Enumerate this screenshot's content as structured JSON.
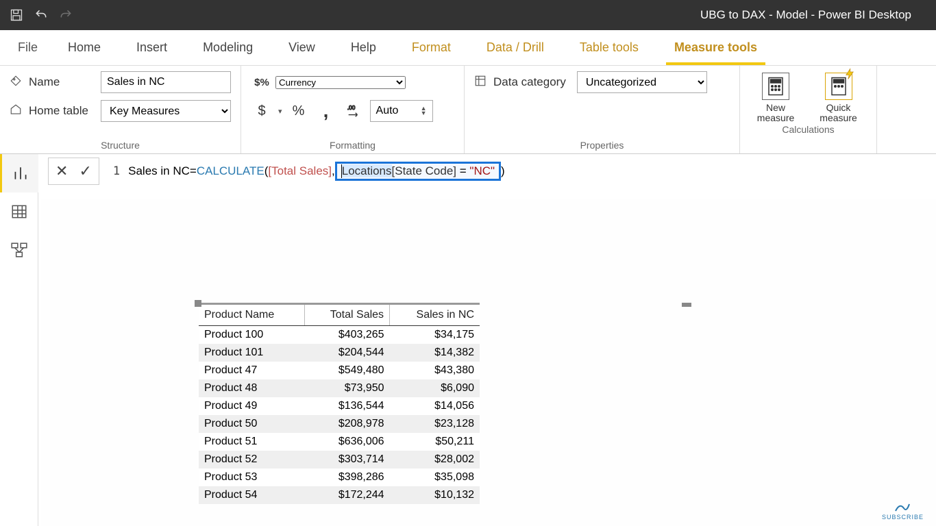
{
  "window_title": "UBG to DAX - Model - Power BI Desktop",
  "tabs": {
    "file": "File",
    "home": "Home",
    "insert": "Insert",
    "modeling": "Modeling",
    "view": "View",
    "help": "Help",
    "format": "Format",
    "datadrill": "Data / Drill",
    "tabletools": "Table tools",
    "measuretools": "Measure tools"
  },
  "ribbon": {
    "structure_label": "Structure",
    "name_label": "Name",
    "name_value": "Sales in NC",
    "home_table_label": "Home table",
    "home_table_value": "Key Measures",
    "formatting_label": "Formatting",
    "format_value": "Currency",
    "decimals_value": "Auto",
    "properties_label": "Properties",
    "data_category_label": "Data category",
    "data_category_value": "Uncategorized",
    "calculations_label": "Calculations",
    "new_measure": "New measure",
    "quick_measure": "Quick measure",
    "dollar": "$",
    "percent": "%",
    "comma": ",",
    "decimals_icon": ".00",
    "format_prefix": "$%"
  },
  "formula": {
    "line_num": "1",
    "measure_name": "Sales in NC",
    "eq": " = ",
    "fn": "CALCULATE",
    "open": "( ",
    "arg_measure": "[Total Sales]",
    "sep": ", ",
    "table_ref": "Locations",
    "col_ref": "[State Code]",
    "eq2": " = ",
    "literal": "\"NC\"",
    "close": " )"
  },
  "table_visual": {
    "columns": [
      "Product Name",
      "Total Sales",
      "Sales in NC"
    ],
    "rows": [
      {
        "name": "Product 100",
        "total": "$403,265",
        "nc": "$34,175"
      },
      {
        "name": "Product 101",
        "total": "$204,544",
        "nc": "$14,382"
      },
      {
        "name": "Product 47",
        "total": "$549,480",
        "nc": "$43,380"
      },
      {
        "name": "Product 48",
        "total": "$73,950",
        "nc": "$6,090"
      },
      {
        "name": "Product 49",
        "total": "$136,544",
        "nc": "$14,056"
      },
      {
        "name": "Product 50",
        "total": "$208,978",
        "nc": "$23,128"
      },
      {
        "name": "Product 51",
        "total": "$636,006",
        "nc": "$50,211"
      },
      {
        "name": "Product 52",
        "total": "$303,714",
        "nc": "$28,002"
      },
      {
        "name": "Product 53",
        "total": "$398,286",
        "nc": "$35,098"
      },
      {
        "name": "Product 54",
        "total": "$172,244",
        "nc": "$10,132"
      }
    ]
  },
  "badge": "SUBSCRIBE"
}
